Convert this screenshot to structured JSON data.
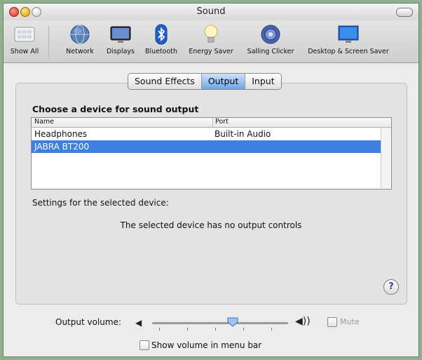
{
  "window": {
    "title": "Sound"
  },
  "toolbar": {
    "items": [
      {
        "label": "Show All",
        "icon": "apple-show-all-icon"
      },
      {
        "label": "Network",
        "icon": "network-globe-icon"
      },
      {
        "label": "Displays",
        "icon": "display-monitor-icon"
      },
      {
        "label": "Bluetooth",
        "icon": "bluetooth-icon"
      },
      {
        "label": "Energy Saver",
        "icon": "lightbulb-icon"
      },
      {
        "label": "Salling Clicker",
        "icon": "clicker-icon"
      },
      {
        "label": "Desktop & Screen Saver",
        "icon": "desktop-icon"
      }
    ]
  },
  "tabs": [
    {
      "label": "Sound Effects",
      "selected": false
    },
    {
      "label": "Output",
      "selected": true
    },
    {
      "label": "Input",
      "selected": false
    }
  ],
  "output": {
    "heading": "Choose a device for sound output",
    "columns": [
      "Name",
      "Port"
    ],
    "rows": [
      {
        "name": "Headphones",
        "port": "Built-in Audio",
        "selected": false
      },
      {
        "name": "JABRA BT200",
        "port": "",
        "selected": true
      }
    ],
    "settings_label": "Settings for the selected device:",
    "no_controls_text": "The selected device has no output controls",
    "help_label": "?"
  },
  "volume": {
    "label": "Output volume:",
    "level": 0.6,
    "mute_label": "Mute",
    "mute_checked": false,
    "menu_bar_label": "Show volume in menu bar",
    "menu_bar_checked": false
  },
  "colors": {
    "selection": "#3d80df",
    "background": "#8fb08c"
  }
}
